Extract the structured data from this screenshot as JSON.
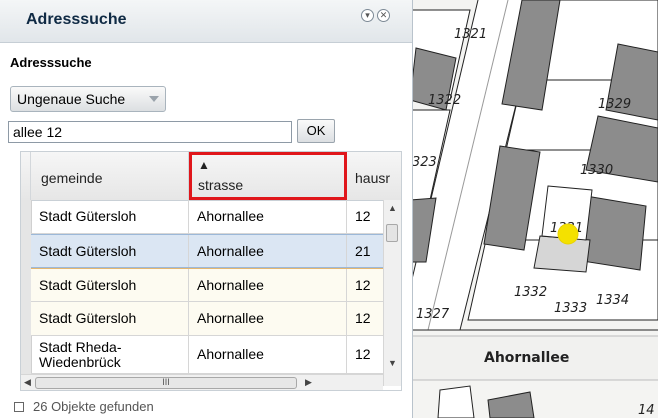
{
  "panel": {
    "title": "Adresssuche",
    "section_label": "Adresssuche",
    "mode_select": {
      "selected": "Ungenaue Suche"
    },
    "search": {
      "value": "allee 12"
    },
    "ok_label": "OK",
    "scroll_thumb_grip": "III"
  },
  "grid": {
    "columns": [
      "gemeinde",
      "strasse",
      "hausr"
    ],
    "sort_indicator": "▲",
    "rows": [
      {
        "gemeinde": "Stadt Gütersloh",
        "strasse": "Ahornallee",
        "hausnr": "12"
      },
      {
        "gemeinde": "Stadt Gütersloh",
        "strasse": "Ahornallee",
        "hausnr": "21"
      },
      {
        "gemeinde": "Stadt Gütersloh",
        "strasse": "Ahornallee",
        "hausnr": "12"
      },
      {
        "gemeinde": "Stadt Gütersloh",
        "strasse": "Ahornallee",
        "hausnr": "12"
      },
      {
        "gemeinde": "Stadt Rheda-\nWiedenbrück",
        "strasse": "Ahornallee",
        "hausnr": "12"
      }
    ]
  },
  "status": {
    "text": "26 Objekte gefunden"
  },
  "map": {
    "street_label": "Ahornallee",
    "parcel_labels": [
      "1321",
      "1322",
      "1329",
      "323",
      "1330",
      "1331",
      "1332",
      "1333",
      "1334",
      "1327",
      "14"
    ],
    "marker_color": "#f4e100"
  },
  "colors": {
    "highlight_border": "#e0161b",
    "selected_row": "#dbe6f3",
    "title_text": "#0f2a44"
  }
}
